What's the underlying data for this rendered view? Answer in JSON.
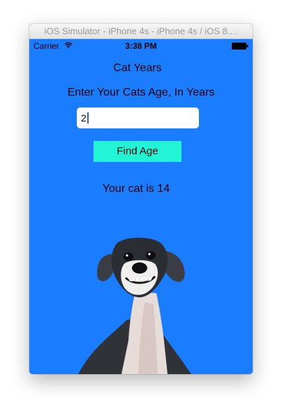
{
  "window": {
    "title": "iOS Simulator - iPhone 4s - iPhone 4s / iOS 8...."
  },
  "status_bar": {
    "carrier": "Carrier",
    "time": "3:38 PM"
  },
  "app": {
    "title": "Cat Years",
    "prompt": "Enter Your Cats Age, In Years",
    "age_input_value": "2",
    "button_label": "Find Age",
    "result_text": "Your cat is 14"
  },
  "colors": {
    "screen_background": "#1a7cff",
    "button_background": "#22f5d6",
    "input_background": "#ffffff"
  },
  "icons": [
    "wifi-icon",
    "battery-icon"
  ]
}
